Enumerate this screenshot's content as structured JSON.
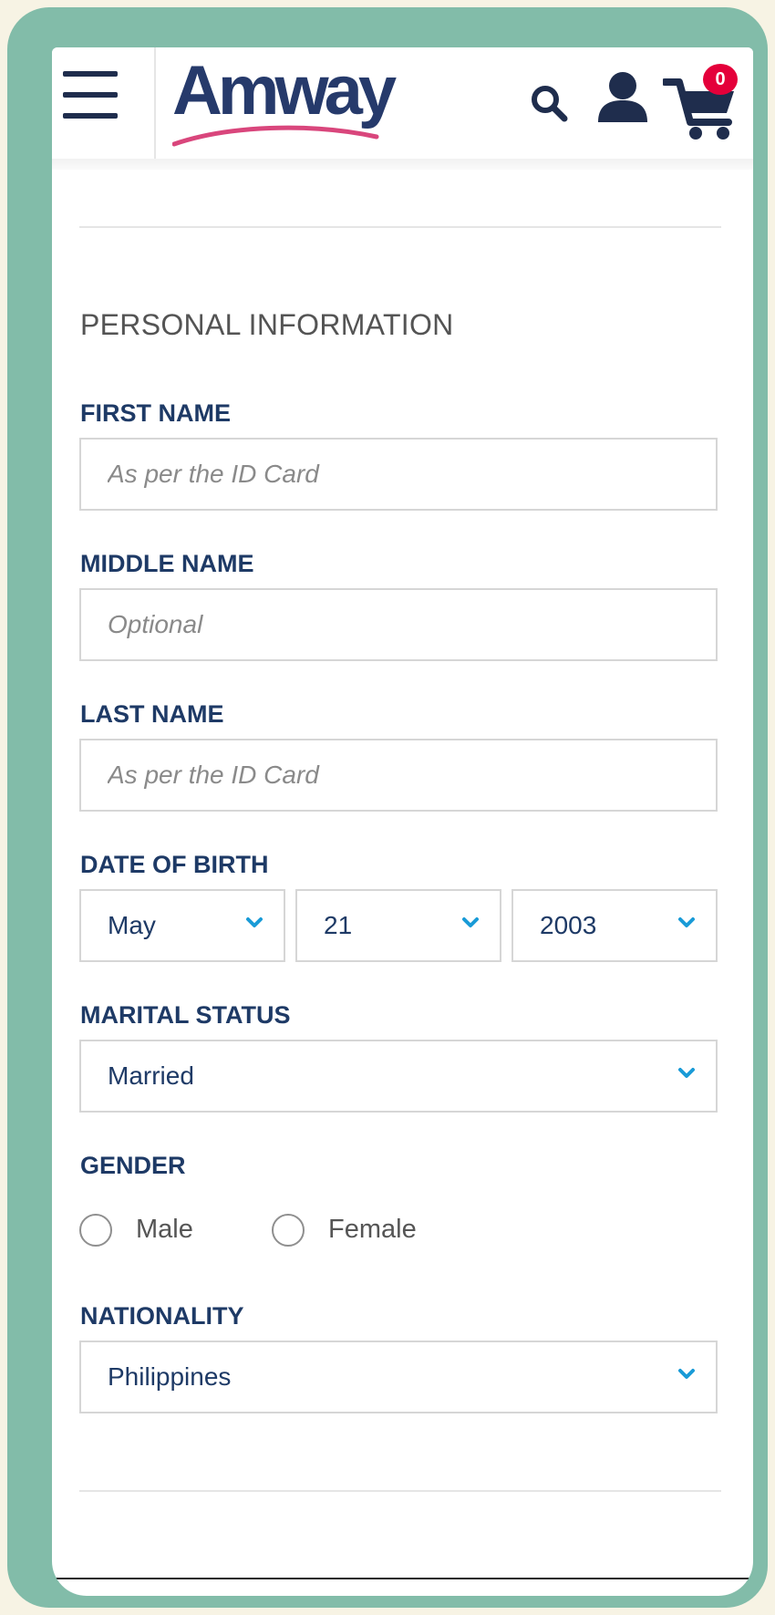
{
  "header": {
    "logo_text": "Amway",
    "cart_count": "0",
    "icons": [
      "menu-icon",
      "search-icon",
      "user-icon",
      "cart-icon"
    ]
  },
  "form": {
    "section_title": "PERSONAL INFORMATION",
    "first_name": {
      "label": "FIRST NAME",
      "placeholder": "As per the ID Card",
      "value": ""
    },
    "middle_name": {
      "label": "MIDDLE NAME",
      "placeholder": "Optional",
      "value": ""
    },
    "last_name": {
      "label": "LAST NAME",
      "placeholder": "As per the ID Card",
      "value": ""
    },
    "date_of_birth": {
      "label": "DATE OF BIRTH",
      "month": "May",
      "day": "21",
      "year": "2003"
    },
    "marital_status": {
      "label": "MARITAL STATUS",
      "value": "Married"
    },
    "gender": {
      "label": "GENDER",
      "options": [
        "Male",
        "Female"
      ],
      "selected": null
    },
    "nationality": {
      "label": "NATIONALITY",
      "value": "Philippines"
    }
  },
  "colors": {
    "frame": "#82bca9",
    "background": "#f7f3e4",
    "label_navy": "#1e3a66",
    "chevron_blue": "#1a9bd7",
    "badge_red": "#e4003a",
    "logo_swoosh": "#d9467c"
  }
}
